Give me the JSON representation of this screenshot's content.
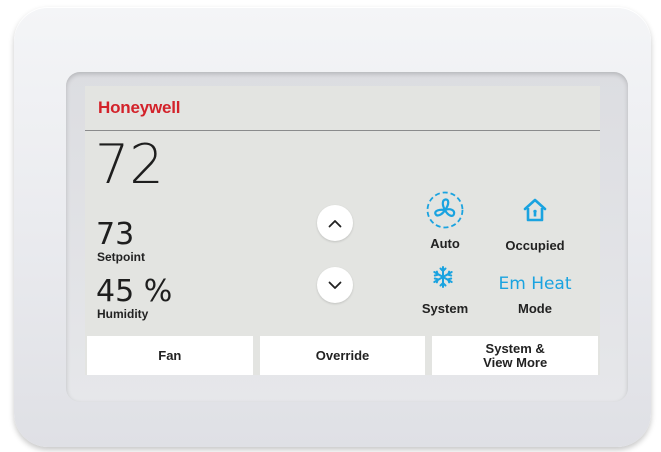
{
  "brand": {
    "name": "Honeywell",
    "color": "#d3222a"
  },
  "display": {
    "temperature": "72",
    "setpoint": {
      "value": "73",
      "label": "Setpoint"
    },
    "humidity": {
      "value": "45 %",
      "label": "Humidity"
    }
  },
  "controls": {
    "up_icon": "chevron-up-icon",
    "down_icon": "chevron-down-icon"
  },
  "status": {
    "fan": {
      "icon": "fan-icon",
      "label": "Auto"
    },
    "occupancy": {
      "icon": "home-icon",
      "label": "Occupied"
    },
    "system": {
      "icon": "snowflake-icon",
      "label": "System"
    },
    "mode": {
      "value": "Em Heat",
      "label": "Mode"
    },
    "accent_color": "#1aa3e0"
  },
  "softkeys": [
    {
      "label": "Fan"
    },
    {
      "label": "Override"
    },
    {
      "label": "System &\nView More"
    }
  ]
}
